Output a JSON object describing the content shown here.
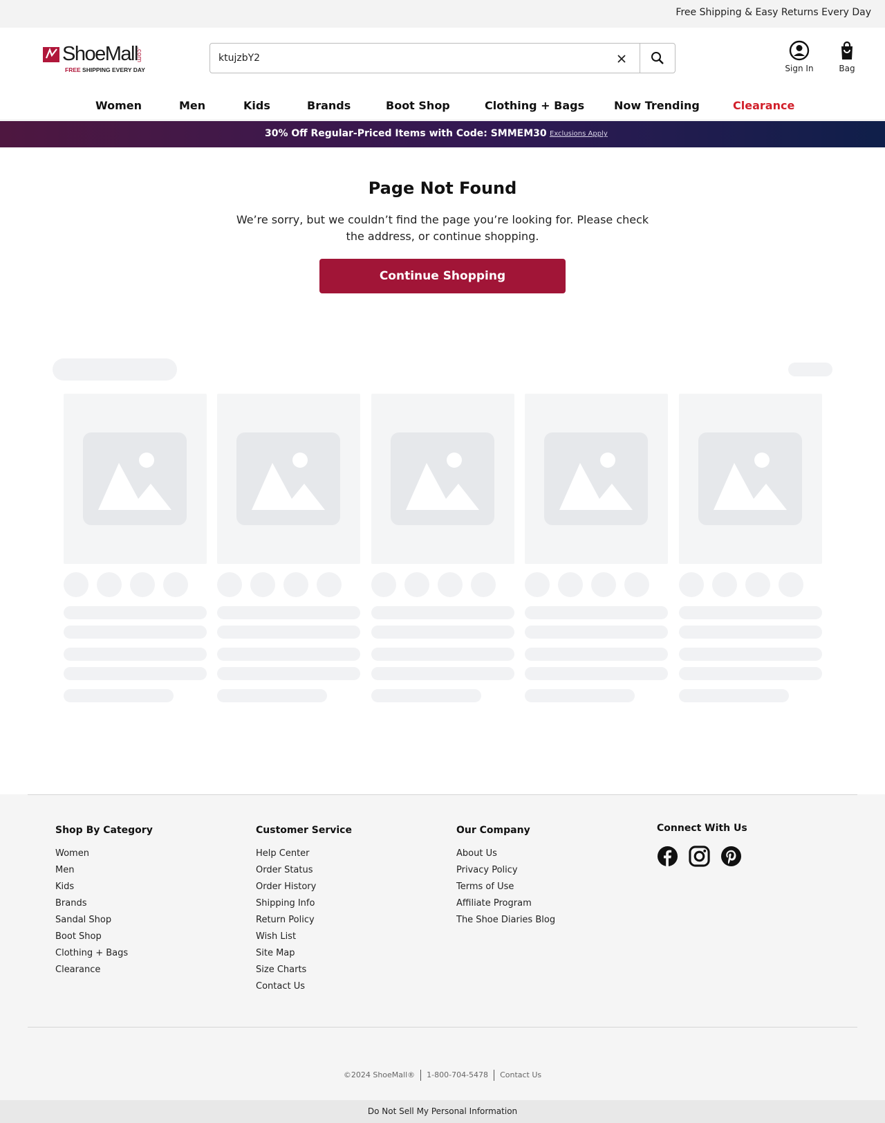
{
  "topbar": {
    "text": "Free Shipping & Easy Returns Every Day"
  },
  "logo": {
    "word": "ShoeMall",
    "com": ".com",
    "tag_free": "FREE",
    "tag_rest": " SHIPPING EVERY DAY"
  },
  "search": {
    "value": "ktujzbY2"
  },
  "header": {
    "signin_label": "Sign In",
    "bag_label": "Bag"
  },
  "nav": {
    "items": [
      "Women",
      "Men",
      "Kids",
      "Brands",
      "Boot Shop",
      "Clothing + Bags",
      "Now Trending",
      "Clearance"
    ]
  },
  "promo": {
    "text": "30% Off Regular-Priced Items with Code: SMMEM30",
    "link": "Exclusions Apply"
  },
  "notfound": {
    "title": "Page Not Found",
    "message": "We’re sorry, but we couldn’t find the page you’re looking for. Please check the address, or continue shopping.",
    "button": "Continue Shopping"
  },
  "footer": {
    "shop_by_category": {
      "heading": "Shop By Category",
      "links": [
        "Women",
        "Men",
        "Kids",
        "Brands",
        "Sandal Shop",
        "Boot Shop",
        "Clothing + Bags",
        "Clearance"
      ]
    },
    "customer_service": {
      "heading": "Customer Service",
      "links": [
        "Help Center",
        "Order Status",
        "Order History",
        "Shipping Info",
        "Return Policy",
        "Wish List",
        "Site Map",
        "Size Charts",
        "Contact Us"
      ]
    },
    "our_company": {
      "heading": "Our Company",
      "links": [
        "About Us",
        "Privacy Policy",
        "Terms of Use",
        "Affiliate Program",
        "The Shoe Diaries Blog"
      ]
    },
    "connect": {
      "heading": "Connect With Us",
      "icons": [
        "facebook-icon",
        "instagram-icon",
        "pinterest-icon"
      ]
    },
    "copyright": "©2024 ShoeMall®",
    "phone": "1-800-704-5478",
    "contact": "Contact Us",
    "do_not_sell": "Do Not Sell My Personal Information"
  },
  "colors": {
    "brand": "#a11537",
    "clearance": "#d11f2a",
    "promo_from": "#4e1740",
    "promo_to": "#0f1f4a"
  }
}
